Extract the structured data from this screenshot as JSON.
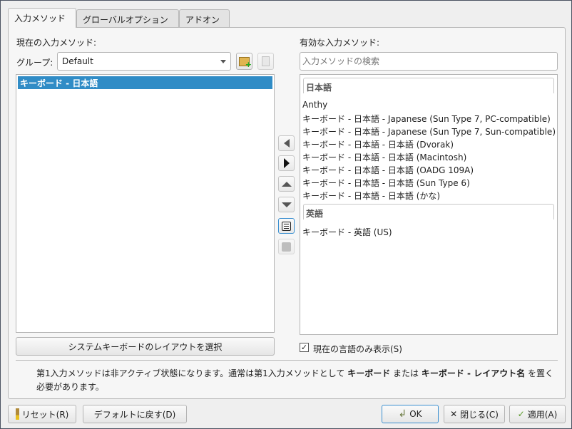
{
  "tabs": [
    "入力メソッド",
    "グローバルオプション",
    "アドオン"
  ],
  "left": {
    "label": "現在の入力メソッド:",
    "group_label": "グループ:",
    "group_value": "Default",
    "items": [
      "キーボード - 日本語"
    ],
    "layout_button": "システムキーボードのレイアウトを選択"
  },
  "right": {
    "label": "有効な入力メソッド:",
    "search_placeholder": "入力メソッドの検索",
    "groups": [
      {
        "header": "日本語",
        "items": [
          "Anthy",
          "キーボード - 日本語 - Japanese (Sun Type 7, PC-compatible)",
          "キーボード - 日本語 - Japanese (Sun Type 7, Sun-compatible)",
          "キーボード - 日本語 - 日本語 (Dvorak)",
          "キーボード - 日本語 - 日本語 (Macintosh)",
          "キーボード - 日本語 - 日本語 (OADG 109A)",
          "キーボード - 日本語 - 日本語 (Sun Type 6)",
          "キーボード - 日本語 - 日本語 (かな)"
        ]
      },
      {
        "header": "英語",
        "items": [
          "キーボード - 英語 (US)"
        ]
      }
    ],
    "checkbox_label": "現在の言語のみ表示(S)",
    "checkbox_checked": true
  },
  "info": {
    "p1": "第1入力メソッドは非アクティブ状態になります。通常は第1入力メソッドとして ",
    "b1": "キーボード",
    "p2": " または ",
    "b2": "キーボード - レイアウト名",
    "p3": " を置く必要があります。"
  },
  "footer": {
    "reset": "リセット(R)",
    "defaults": "デフォルトに戻す(D)",
    "ok": "OK",
    "close": "閉じる(C)",
    "apply": "適用(A)"
  },
  "colors": {
    "selection": "#308cc6",
    "accent_border": "#3a8fd0"
  }
}
